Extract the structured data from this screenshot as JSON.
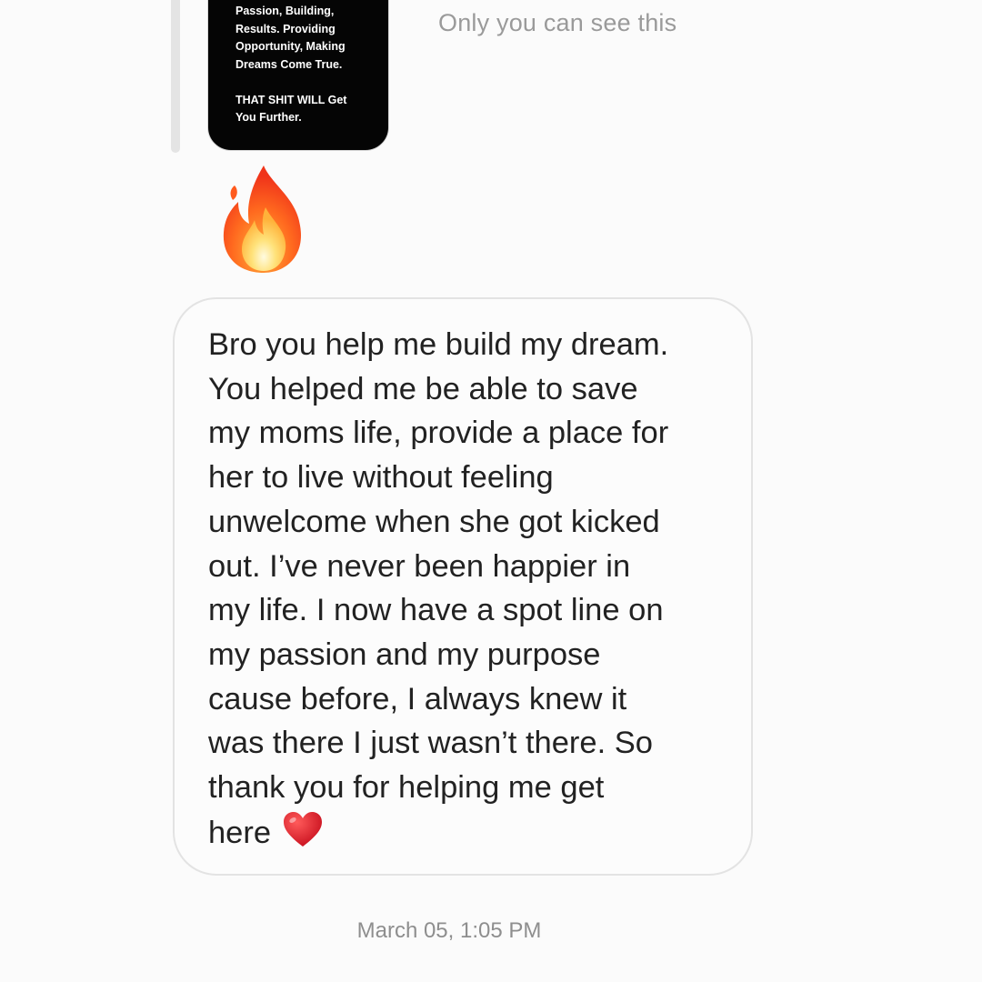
{
  "story_reply": {
    "text": "Passion, Building,\nResults. Providing\nOpportunity, Making\nDreams Come True.\n\nTHAT SHIT WILL Get\nYou Further."
  },
  "visibility_note": "Only you can see this",
  "reaction_emoji": "fire-emoji",
  "message": {
    "text": "Bro you help me build my dream.\nYou helped me be able to save\nmy moms life, provide a place for\nher to live without feeling\nunwelcome when she got kicked\nout. I’ve never been happier in\nmy life. I now have a spot line on\nmy passion and my purpose\ncause before, I always knew it\nwas there I just wasn’t there. So\nthank you for helping me get\nhere",
    "trailing_emoji": "red-heart-emoji"
  },
  "timestamp": "March 05, 1:05 PM",
  "colors": {
    "background": "#fbfbfb",
    "bubble_border": "#e3e3e3",
    "story_card": "#050505",
    "muted_text": "#9a9a9a"
  }
}
